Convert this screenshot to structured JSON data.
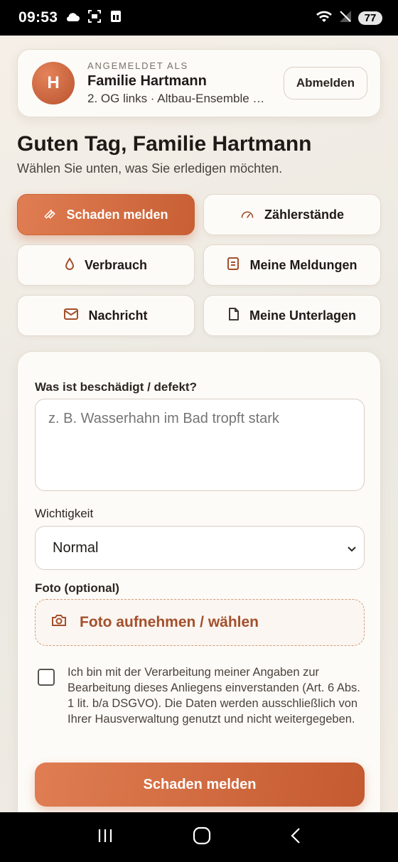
{
  "status_bar": {
    "time": "09:53",
    "battery": "77",
    "icons": [
      "cloud-icon",
      "screenshot-icon",
      "sim-icon",
      "wifi-icon",
      "no-signal-icon"
    ]
  },
  "account": {
    "avatar_initial": "H",
    "label": "ANGEMELDET ALS",
    "name": "Familie Hartmann",
    "unit": "2. OG links · Altbau-Ensemble …",
    "logout_label": "Abmelden"
  },
  "greeting": {
    "title": "Guten Tag, Familie Hartmann",
    "subtitle": "Wählen Sie unten, was Sie erledigen möchten."
  },
  "actions": [
    {
      "label": "Schaden melden",
      "icon": "wrench-icon",
      "active": true
    },
    {
      "label": "Zählerstände",
      "icon": "gauge-icon",
      "active": false
    },
    {
      "label": "Verbrauch",
      "icon": "drop-icon",
      "active": false
    },
    {
      "label": "Meine Meldungen",
      "icon": "clipboard-icon",
      "active": false
    },
    {
      "label": "Nachricht",
      "icon": "mail-icon",
      "active": false
    },
    {
      "label": "Meine Unterlagen",
      "icon": "document-icon",
      "active": false
    }
  ],
  "form": {
    "description_label": "Was ist beschädigt / defekt?",
    "description_placeholder": "z. B. Wasserhahn im Bad tropft stark",
    "priority_label": "Wichtigkeit",
    "priority_value": "Normal",
    "photo_label": "Foto (optional)",
    "photo_button": "Foto aufnehmen / wählen",
    "consent_text": "Ich bin mit der Verarbeitung meiner Angaben zur Bearbeitung dieses Anliegens einverstanden (Art. 6 Abs. 1 lit. b/a DSGVO). Die Daten werden ausschließlich von Ihrer Hausverwaltung genutzt und nicht weitergegeben.",
    "consent_checked": false,
    "submit_label": "Schaden melden"
  },
  "colors": {
    "accent": "#d0683d",
    "accent_dark": "#c45a30",
    "text": "#1f1a17",
    "background": "#f3ede5"
  }
}
